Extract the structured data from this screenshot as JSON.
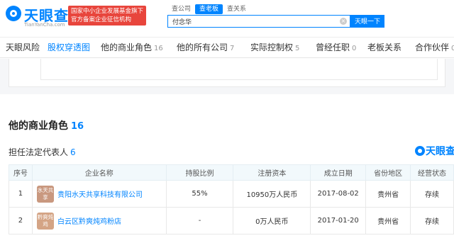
{
  "header": {
    "logo_text": "天眼查",
    "logo_sub": "TianYanCha.com",
    "badge_line1": "国家中小企业发展基金旗下",
    "badge_line2": "官方备案企业征信机构",
    "search_tabs": [
      "查公司",
      "查老板",
      "查关系"
    ],
    "search_value": "付念华",
    "search_button": "天眼一下",
    "clear_icon": "×"
  },
  "nav": {
    "items": [
      {
        "label": "天眼风险",
        "count": ""
      },
      {
        "label": "股权穿透图",
        "count": ""
      },
      {
        "label": "他的商业角色",
        "count": "16"
      },
      {
        "label": "他的所有公司",
        "count": "7"
      },
      {
        "label": "实际控制权",
        "count": "5"
      },
      {
        "label": "曾经任职",
        "count": "0"
      },
      {
        "label": "老板关系",
        "count": ""
      },
      {
        "label": "合作伙伴",
        "count": "0"
      }
    ]
  },
  "section": {
    "title": "他的商业角色",
    "count": "16",
    "subtitle": "担任法定代表人",
    "subcount": "6",
    "watermark": "天眼查"
  },
  "table": {
    "headers": [
      "序号",
      "企业名称",
      "持股比例",
      "注册资本",
      "成立日期",
      "省份地区",
      "经营状态"
    ],
    "rows": [
      {
        "no": "1",
        "logo": "水天共享",
        "name": "贵阳水天共享科技有限公司",
        "share": "55%",
        "capital": "10950万人民币",
        "date": "2017-08-02",
        "region": "贵州省",
        "status": "存续"
      },
      {
        "no": "2",
        "logo": "黔爽炖鸡",
        "name": "白云区黔爽炖鸡粉店",
        "share": "-",
        "capital": "0万人民币",
        "date": "2017-01-20",
        "region": "贵州省",
        "status": "存续"
      }
    ]
  },
  "colors": {
    "accent": "#0084ff",
    "badge": "#e8453c",
    "status": "#23a05b"
  }
}
